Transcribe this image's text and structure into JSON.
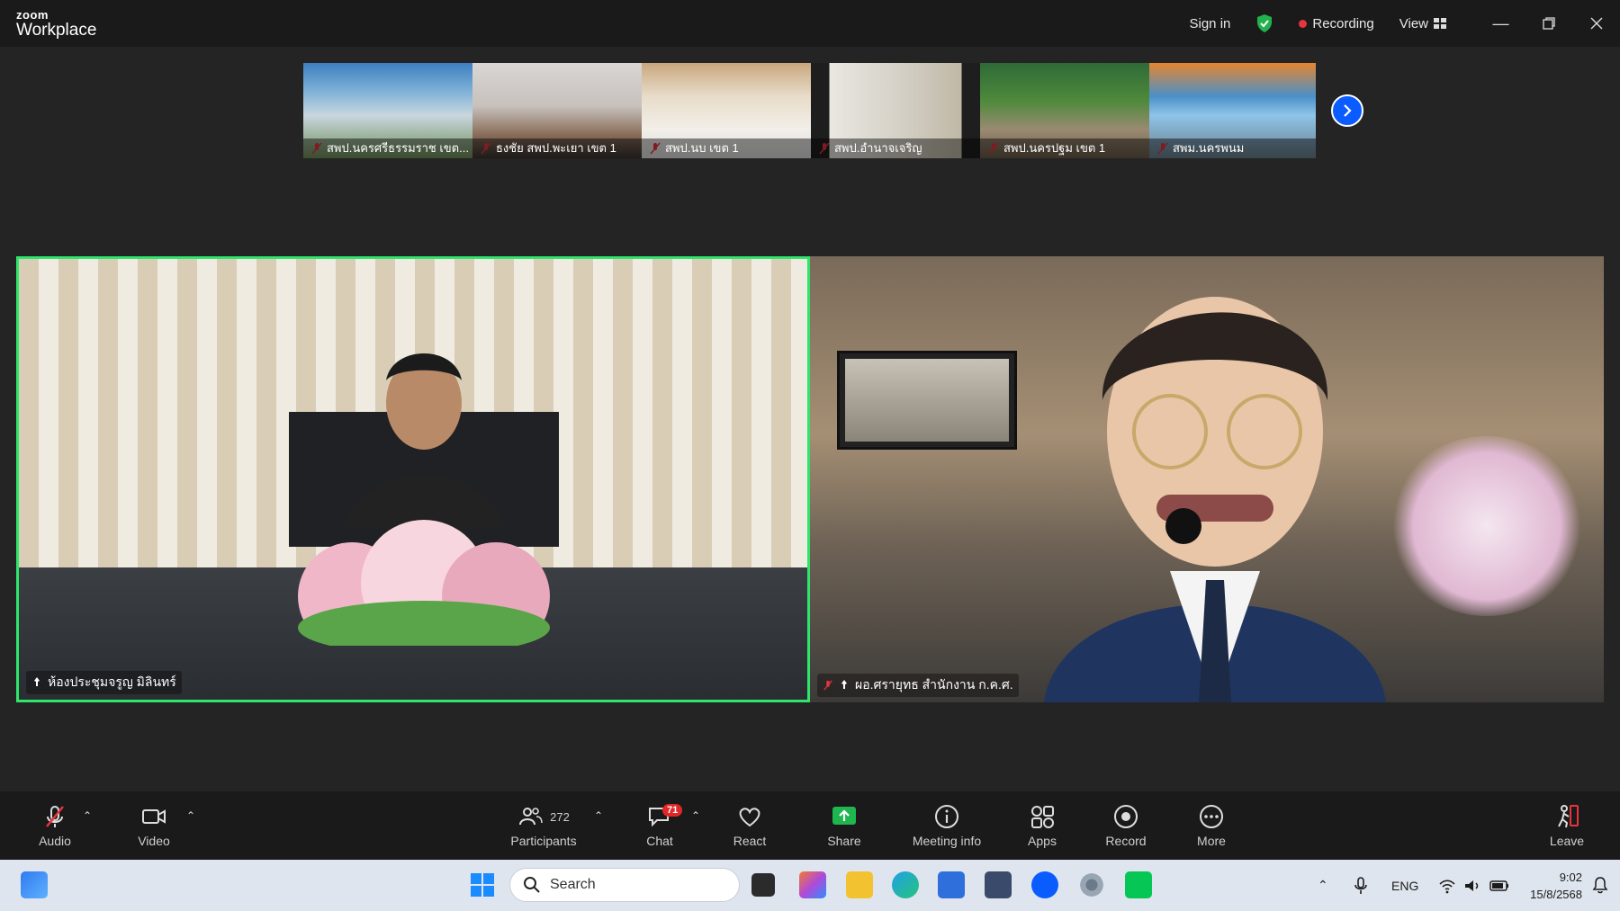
{
  "app": {
    "brand_small": "zoom",
    "brand_big": "Workplace"
  },
  "titlebar": {
    "sign_in": "Sign in",
    "recording": "Recording",
    "view": "View"
  },
  "thumbnails": [
    {
      "label": "สพป.นครศรีธรรมราช เขต..."
    },
    {
      "label": "ธงชัย สพป.พะเยา เขต 1"
    },
    {
      "label": "สพป.นบ เขต 1"
    },
    {
      "label": "สพป.อำนาจเจริญ"
    },
    {
      "label": "สพป.นครปฐม เขต 1"
    },
    {
      "label": "สพม.นครพนม"
    }
  ],
  "videos": [
    {
      "label": "ห้องประชุมจรูญ มิลินทร์"
    },
    {
      "label": "ผอ.ศรายุทธ สำนักงาน ก.ค.ศ."
    }
  ],
  "toolbar": {
    "audio": "Audio",
    "video": "Video",
    "participants": "Participants",
    "participants_count": "272",
    "chat": "Chat",
    "chat_badge": "71",
    "react": "React",
    "share": "Share",
    "meeting_info": "Meeting info",
    "apps": "Apps",
    "record": "Record",
    "more": "More",
    "leave": "Leave"
  },
  "taskbar": {
    "search_placeholder": "Search",
    "lang": "ENG",
    "time": "9:02",
    "date": "15/8/2568"
  },
  "colors": {
    "accent": "#0b5cff",
    "active_speaker": "#2ee66b",
    "share_green": "#1fb54f",
    "rec_red": "#e8343d"
  }
}
